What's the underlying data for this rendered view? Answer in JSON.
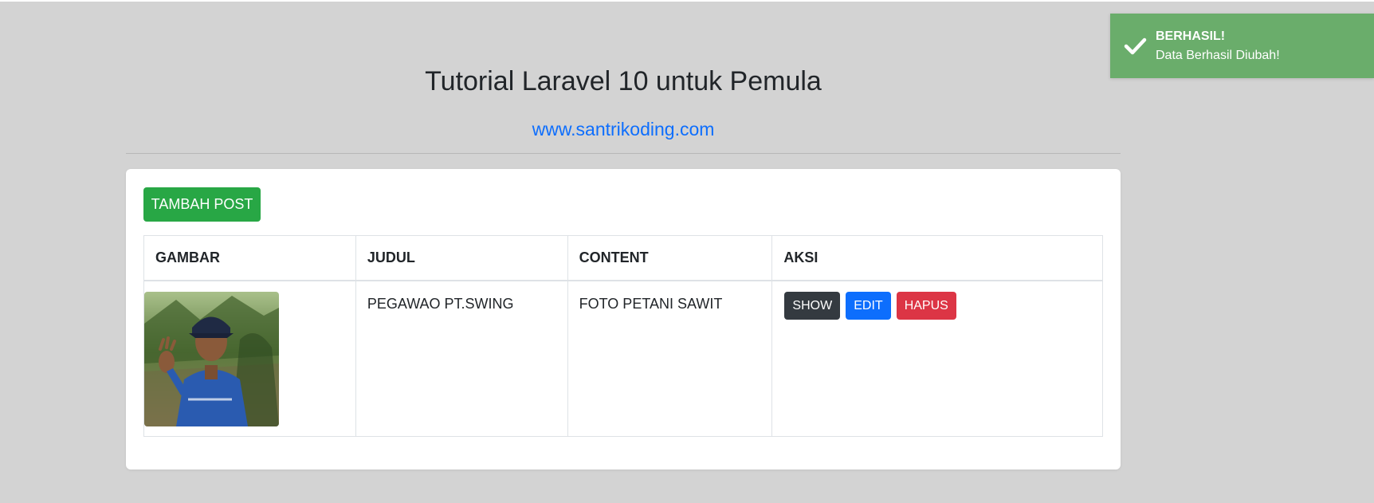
{
  "header": {
    "title": "Tutorial Laravel 10 untuk Pemula",
    "link_text": "www.santrikoding.com"
  },
  "toolbar": {
    "add_label": "TAMBAH POST"
  },
  "table": {
    "columns": [
      "GAMBAR",
      "JUDUL",
      "CONTENT",
      "AKSI"
    ],
    "rows": [
      {
        "image_alt": "farmer photo",
        "title": "PEGAWAO PT.SWING",
        "content": "FOTO PETANI SAWIT",
        "actions": {
          "show": "SHOW",
          "edit": "EDIT",
          "delete": "HAPUS"
        }
      }
    ]
  },
  "toast": {
    "title": "BERHASIL!",
    "message": "Data Berhasil Diubah!",
    "icon": "check-icon"
  },
  "colors": {
    "background": "#d3d3d3",
    "success": "#28a745",
    "primary": "#0d6efd",
    "danger": "#dc3545",
    "dark": "#343a40",
    "toast": "#6aad6b"
  }
}
